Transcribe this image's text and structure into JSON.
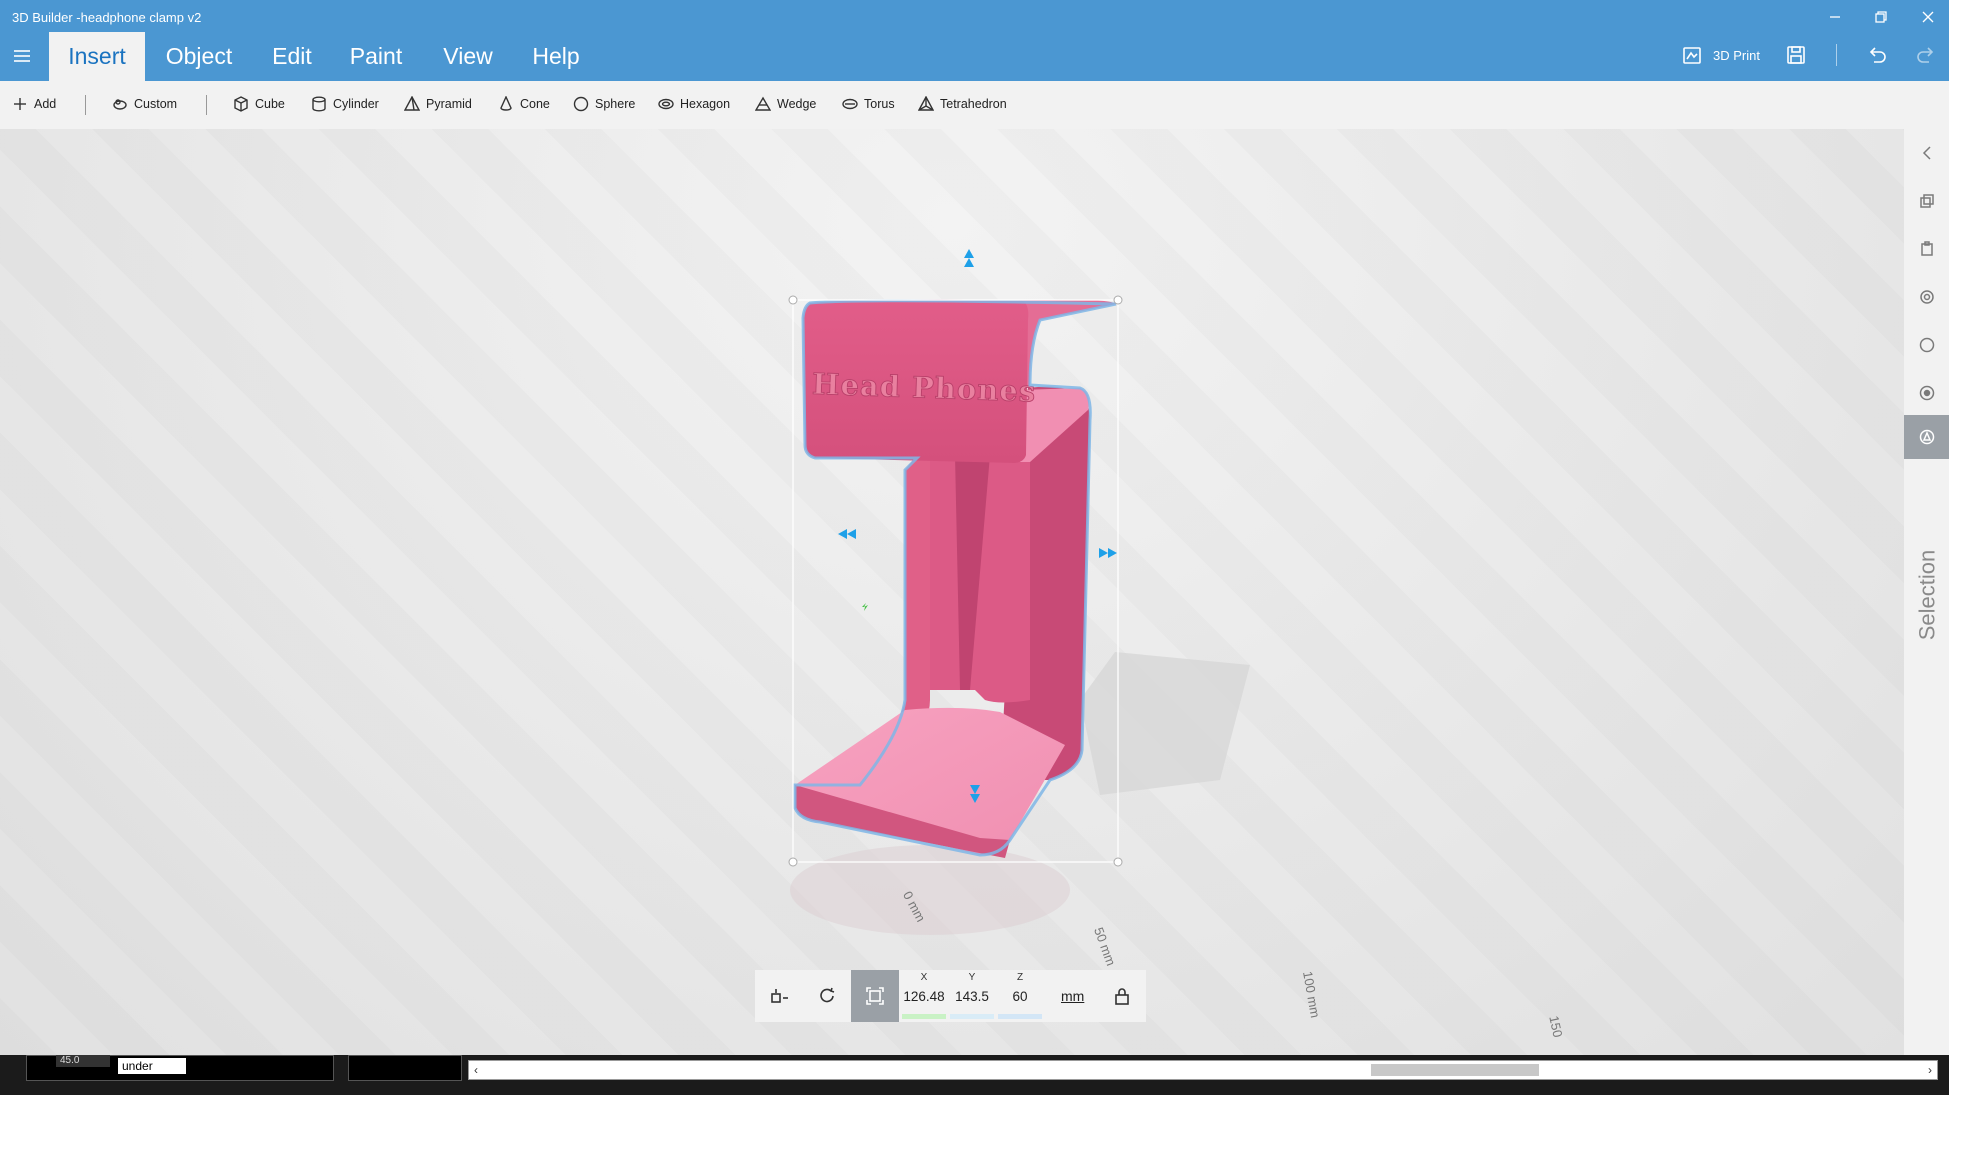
{
  "window": {
    "title": "3D Builder -headphone clamp v2"
  },
  "menu": {
    "tabs": [
      {
        "label": "Insert",
        "active": true
      },
      {
        "label": "Object",
        "active": false
      },
      {
        "label": "Edit",
        "active": false
      },
      {
        "label": "Paint",
        "active": false
      },
      {
        "label": "View",
        "active": false
      },
      {
        "label": "Help",
        "active": false
      }
    ],
    "print_label": "3D Print"
  },
  "toolbar": {
    "add_label": "Add",
    "custom_label": "Custom",
    "shapes": [
      {
        "label": "Cube",
        "icon": "cube-icon"
      },
      {
        "label": "Cylinder",
        "icon": "cylinder-icon"
      },
      {
        "label": "Pyramid",
        "icon": "pyramid-icon"
      },
      {
        "label": "Cone",
        "icon": "cone-icon"
      },
      {
        "label": "Sphere",
        "icon": "sphere-icon"
      },
      {
        "label": "Hexagon",
        "icon": "hexagon-icon"
      },
      {
        "label": "Wedge",
        "icon": "wedge-icon"
      },
      {
        "label": "Torus",
        "icon": "torus-icon"
      },
      {
        "label": "Tetrahedron",
        "icon": "tetrahedron-icon"
      }
    ]
  },
  "model": {
    "embossed_text": "Head Phones",
    "color": "#e8658f"
  },
  "sidebar": {
    "selection_label": "Selection"
  },
  "transform": {
    "x_label": "X",
    "x_value": "126.48",
    "y_label": "Y",
    "y_value": "143.5",
    "z_label": "Z",
    "z_value": "60",
    "unit": "mm"
  },
  "rulers": [
    "0 mm",
    "50 mm",
    "100 mm",
    "150"
  ],
  "overlay": {
    "angle_value": "45.0",
    "field_text": "under"
  },
  "colors": {
    "accent": "#4b97d2",
    "selection_outline": "#7fb6e6",
    "handle": "#1ea0e8"
  }
}
